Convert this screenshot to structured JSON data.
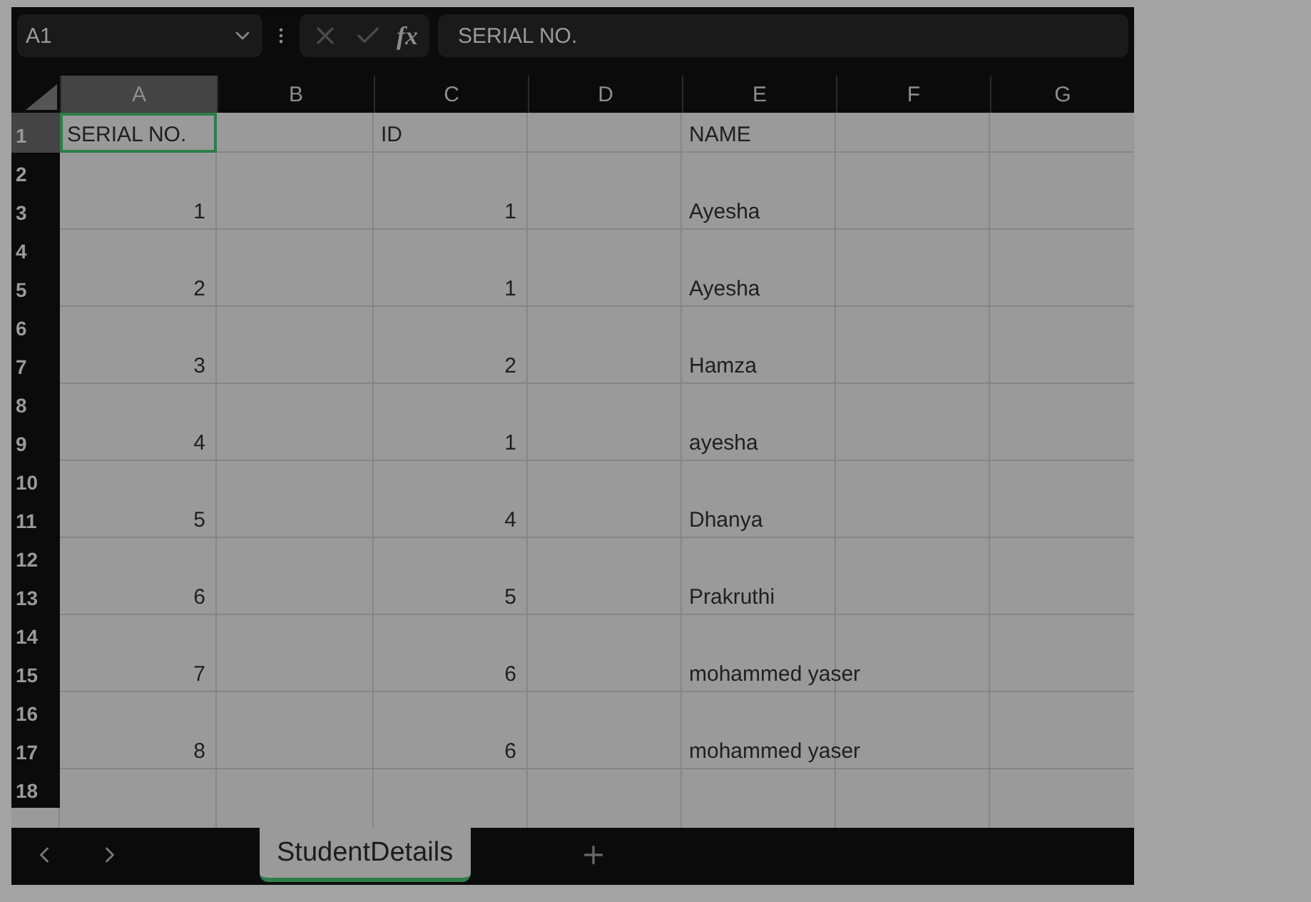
{
  "name_box": {
    "value": "A1"
  },
  "formula_bar": {
    "function_label": "fx",
    "value": "SERIAL NO."
  },
  "columns": [
    {
      "label": "A",
      "selected": true
    },
    {
      "label": "B",
      "selected": false
    },
    {
      "label": "C",
      "selected": false
    },
    {
      "label": "D",
      "selected": false
    },
    {
      "label": "E",
      "selected": false
    },
    {
      "label": "F",
      "selected": false
    },
    {
      "label": "G",
      "selected": false
    }
  ],
  "rows": [
    {
      "number": "1",
      "selected": true,
      "column_a": {
        "text": "SERIAL NO.",
        "kind": "text"
      },
      "column_c": {
        "text": "ID",
        "kind": "text"
      },
      "column_e": {
        "text": "NAME",
        "kind": "text"
      }
    },
    {
      "number": "2",
      "selected": false
    },
    {
      "number": "3",
      "selected": false,
      "column_a": {
        "text": "1",
        "kind": "number"
      },
      "column_c": {
        "text": "1",
        "kind": "number"
      },
      "column_e": {
        "text": "Ayesha",
        "kind": "text"
      }
    },
    {
      "number": "4",
      "selected": false
    },
    {
      "number": "5",
      "selected": false,
      "column_a": {
        "text": "2",
        "kind": "number"
      },
      "column_c": {
        "text": "1",
        "kind": "number"
      },
      "column_e": {
        "text": "Ayesha",
        "kind": "text"
      }
    },
    {
      "number": "6",
      "selected": false
    },
    {
      "number": "7",
      "selected": false,
      "column_a": {
        "text": "3",
        "kind": "number"
      },
      "column_c": {
        "text": "2",
        "kind": "number"
      },
      "column_e": {
        "text": "Hamza",
        "kind": "text"
      }
    },
    {
      "number": "8",
      "selected": false
    },
    {
      "number": "9",
      "selected": false,
      "column_a": {
        "text": "4",
        "kind": "number"
      },
      "column_c": {
        "text": "1",
        "kind": "number"
      },
      "column_e": {
        "text": "ayesha",
        "kind": "text"
      }
    },
    {
      "number": "10",
      "selected": false
    },
    {
      "number": "11",
      "selected": false,
      "column_a": {
        "text": "5",
        "kind": "number"
      },
      "column_c": {
        "text": "4",
        "kind": "number"
      },
      "column_e": {
        "text": "Dhanya",
        "kind": "text"
      }
    },
    {
      "number": "12",
      "selected": false
    },
    {
      "number": "13",
      "selected": false,
      "column_a": {
        "text": "6",
        "kind": "number"
      },
      "column_c": {
        "text": "5",
        "kind": "number"
      },
      "column_e": {
        "text": "Prakruthi",
        "kind": "text"
      }
    },
    {
      "number": "14",
      "selected": false
    },
    {
      "number": "15",
      "selected": false,
      "column_a": {
        "text": "7",
        "kind": "number"
      },
      "column_c": {
        "text": "6",
        "kind": "number"
      },
      "column_e": {
        "text": "mohammed yaser",
        "kind": "text"
      }
    },
    {
      "number": "16",
      "selected": false
    },
    {
      "number": "17",
      "selected": false,
      "column_a": {
        "text": "8",
        "kind": "number"
      },
      "column_c": {
        "text": "6",
        "kind": "number"
      },
      "column_e": {
        "text": "mohammed yaser",
        "kind": "text"
      }
    },
    {
      "number": "18",
      "selected": false
    }
  ],
  "sheet_tabs": [
    {
      "label": "StudentDetails",
      "selected": true
    }
  ]
}
